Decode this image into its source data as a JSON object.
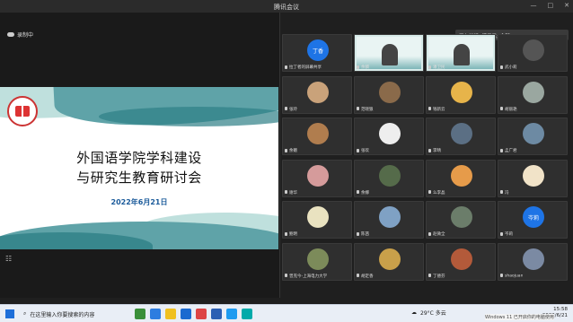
{
  "window": {
    "title": "腾讯会议",
    "controls": [
      "—",
      "□",
      "✕"
    ]
  },
  "stage": {
    "recording_label": "录制中",
    "slide": {
      "title_line1": "外国语学院学科建设",
      "title_line2": "与研究生教育研讨会",
      "date": "2022年6月21日"
    }
  },
  "speaker_bar": {
    "text": "正在讲话: 潘卫民; 余麟;"
  },
  "participants": [
    {
      "name": "拉丁者的屏幕共享",
      "avatar_text": "丁香",
      "type": "avatar",
      "color": "#1e74e6"
    },
    {
      "name": "余麟",
      "type": "video"
    },
    {
      "name": "潘卫民",
      "type": "video"
    },
    {
      "name": "武小莉",
      "type": "avatar",
      "color": "#555"
    },
    {
      "name": "张玲",
      "type": "avatar",
      "color": "#c9a27a"
    },
    {
      "name": "范晓狼",
      "type": "avatar",
      "color": "#8a6a4a"
    },
    {
      "name": "钱新云",
      "type": "avatar",
      "color": "#e7b44a"
    },
    {
      "name": "胡丽艳",
      "type": "avatar",
      "color": "#9aa7a0"
    },
    {
      "name": "余娥",
      "type": "avatar",
      "color": "#b07d4e"
    },
    {
      "name": "张欢",
      "type": "avatar",
      "color": "#eee"
    },
    {
      "name": "李晴",
      "type": "avatar",
      "color": "#5b6f84"
    },
    {
      "name": "孟广君",
      "type": "avatar",
      "color": "#6d8aa3"
    },
    {
      "name": "谢华",
      "type": "avatar",
      "color": "#d59b9b"
    },
    {
      "name": "余娜",
      "type": "avatar",
      "color": "#556b4a"
    },
    {
      "name": "么李晶",
      "type": "avatar",
      "color": "#e69b4a"
    },
    {
      "name": "冯",
      "type": "avatar",
      "color": "#f1e3c8"
    },
    {
      "name": "鲍明",
      "type": "avatar",
      "color": "#e9e2c0"
    },
    {
      "name": "陈茜",
      "type": "avatar",
      "color": "#7fa1c4"
    },
    {
      "name": "赵微全",
      "type": "avatar",
      "color": "#6b7d6a"
    },
    {
      "name": "岑莉",
      "avatar_text": "岑莉",
      "type": "avatar",
      "color": "#1e74e6"
    },
    {
      "name": "曾克今-上海电力大学",
      "type": "avatar",
      "color": "#7c8b5a"
    },
    {
      "name": "胡定香",
      "type": "avatar",
      "color": "#c9a04a"
    },
    {
      "name": "丁德芬",
      "type": "avatar",
      "color": "#b35a3a"
    },
    {
      "name": "shaojuan",
      "type": "avatar",
      "color": "#7b8aa3"
    }
  ],
  "taskbar": {
    "search_placeholder": "在这里输入你要搜索的内容",
    "weather": "29°C 多云",
    "time": "15:58",
    "date": "2022/6/21",
    "activation": "Windows 11 已开启你的电脑使用"
  },
  "colors": {
    "accent": "#1e74e6",
    "slide_teal": "#5fa3a8",
    "date_blue": "#1a5a9a"
  }
}
